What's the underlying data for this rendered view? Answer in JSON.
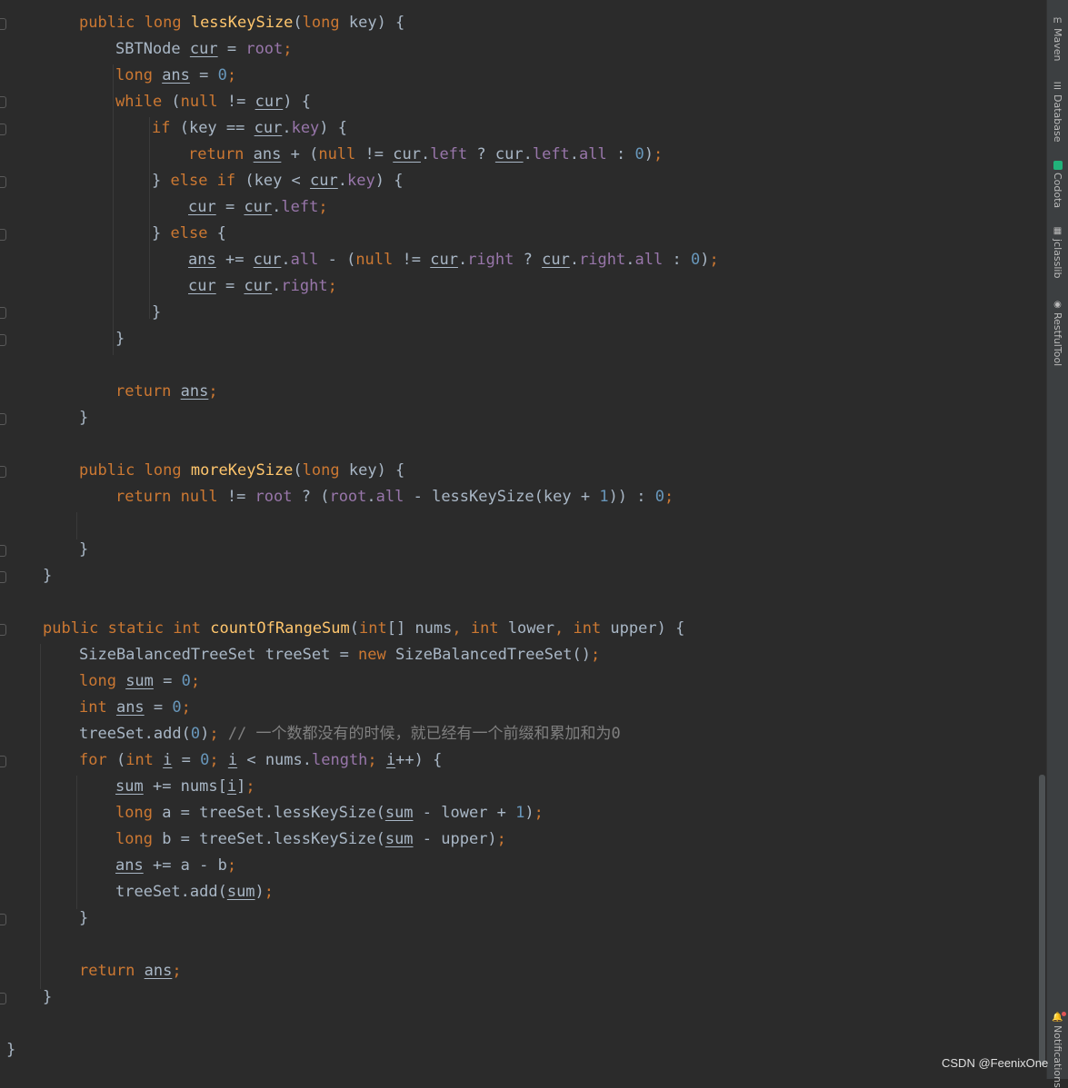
{
  "tool_windows": [
    {
      "label": "Maven",
      "icon": "maven-icon"
    },
    {
      "label": "Database",
      "icon": "database-icon"
    },
    {
      "label": "Codota",
      "icon": "codota-icon"
    },
    {
      "label": "jclasslib",
      "icon": "jclasslib-icon"
    },
    {
      "label": "RestfulTool",
      "icon": "restful-tool-icon"
    },
    {
      "label": "Notifications",
      "icon": "notifications-icon"
    }
  ],
  "watermark": "CSDN @FeenixOne",
  "colors": {
    "background": "#2b2b2b",
    "keyword": "#cc7832",
    "function": "#ffc66d",
    "number": "#6897bb",
    "field": "#9876aa",
    "comment": "#808080",
    "text": "#a9b7c6"
  },
  "code": [
    [
      [
        "kw",
        "public long "
      ],
      [
        "fn",
        "lessKeySize"
      ],
      [
        "",
        "("
      ],
      [
        "kw",
        "long "
      ],
      [
        "",
        "key) {"
      ]
    ],
    [
      [
        "",
        "SBTNode "
      ],
      [
        "var",
        "cur"
      ],
      [
        "",
        " = "
      ],
      [
        "fld",
        "root"
      ],
      [
        "kw",
        ";"
      ]
    ],
    [
      [
        "kw",
        "long "
      ],
      [
        "var",
        "ans"
      ],
      [
        "",
        " = "
      ],
      [
        "num",
        "0"
      ],
      [
        "kw",
        ";"
      ]
    ],
    [
      [
        "kw",
        "while "
      ],
      [
        "",
        "("
      ],
      [
        "kw",
        "null "
      ],
      [
        "",
        "!= "
      ],
      [
        "var",
        "cur"
      ],
      [
        "",
        ") {"
      ]
    ],
    [
      [
        "kw",
        "if "
      ],
      [
        "",
        "(key == "
      ],
      [
        "var",
        "cur"
      ],
      [
        "",
        "."
      ],
      [
        "fld",
        "key"
      ],
      [
        "",
        ") {"
      ]
    ],
    [
      [
        "kw",
        "return "
      ],
      [
        "var",
        "ans"
      ],
      [
        "",
        " + ("
      ],
      [
        "kw",
        "null "
      ],
      [
        "",
        "!= "
      ],
      [
        "var",
        "cur"
      ],
      [
        "",
        "."
      ],
      [
        "fld",
        "left"
      ],
      [
        "",
        " ? "
      ],
      [
        "var",
        "cur"
      ],
      [
        "",
        "."
      ],
      [
        "fld",
        "left"
      ],
      [
        "",
        "."
      ],
      [
        "fld",
        "all"
      ],
      [
        "",
        " : "
      ],
      [
        "num",
        "0"
      ],
      [
        "",
        ")"
      ],
      [
        "kw",
        ";"
      ]
    ],
    [
      [
        "",
        "} "
      ],
      [
        "kw",
        "else if "
      ],
      [
        "",
        "(key < "
      ],
      [
        "var",
        "cur"
      ],
      [
        "",
        "."
      ],
      [
        "fld",
        "key"
      ],
      [
        "",
        ") {"
      ]
    ],
    [
      [
        "var",
        "cur"
      ],
      [
        "",
        " = "
      ],
      [
        "var",
        "cur"
      ],
      [
        "",
        "."
      ],
      [
        "fld",
        "left"
      ],
      [
        "kw",
        ";"
      ]
    ],
    [
      [
        "",
        "} "
      ],
      [
        "kw",
        "else "
      ],
      [
        "",
        "{"
      ]
    ],
    [
      [
        "var",
        "ans"
      ],
      [
        "",
        " += "
      ],
      [
        "var",
        "cur"
      ],
      [
        "",
        "."
      ],
      [
        "fld",
        "all"
      ],
      [
        "",
        " - ("
      ],
      [
        "kw",
        "null "
      ],
      [
        "",
        "!= "
      ],
      [
        "var",
        "cur"
      ],
      [
        "",
        "."
      ],
      [
        "fld",
        "right"
      ],
      [
        "",
        " ? "
      ],
      [
        "var",
        "cur"
      ],
      [
        "",
        "."
      ],
      [
        "fld",
        "right"
      ],
      [
        "",
        "."
      ],
      [
        "fld",
        "all"
      ],
      [
        "",
        " : "
      ],
      [
        "num",
        "0"
      ],
      [
        "",
        ")"
      ],
      [
        "kw",
        ";"
      ]
    ],
    [
      [
        "var",
        "cur"
      ],
      [
        "",
        " = "
      ],
      [
        "var",
        "cur"
      ],
      [
        "",
        "."
      ],
      [
        "fld",
        "right"
      ],
      [
        "kw",
        ";"
      ]
    ],
    [
      [
        "",
        "}"
      ]
    ],
    [
      [
        "",
        "}"
      ]
    ],
    [],
    [
      [
        "kw",
        "return "
      ],
      [
        "var",
        "ans"
      ],
      [
        "kw",
        ";"
      ]
    ],
    [
      [
        "",
        "}"
      ]
    ],
    [],
    [
      [
        "kw",
        "public long "
      ],
      [
        "fn",
        "moreKeySize"
      ],
      [
        "",
        "("
      ],
      [
        "kw",
        "long "
      ],
      [
        "",
        "key) {"
      ]
    ],
    [
      [
        "kw",
        "return null "
      ],
      [
        "",
        "!= "
      ],
      [
        "fld",
        "root"
      ],
      [
        "",
        " ? ("
      ],
      [
        "fld",
        "root"
      ],
      [
        "",
        "."
      ],
      [
        "fld",
        "all"
      ],
      [
        "",
        " - lessKeySize(key + "
      ],
      [
        "num",
        "1"
      ],
      [
        "",
        ")) : "
      ],
      [
        "num",
        "0"
      ],
      [
        "kw",
        ";"
      ]
    ],
    [],
    [
      [
        "",
        "}"
      ]
    ],
    [
      [
        "",
        "}"
      ]
    ],
    [],
    [
      [
        "kw",
        "public static int "
      ],
      [
        "fn",
        "countOfRangeSum"
      ],
      [
        "",
        "("
      ],
      [
        "kw",
        "int"
      ],
      [
        "",
        "[] nums"
      ],
      [
        "kw",
        ", int "
      ],
      [
        "",
        "lower"
      ],
      [
        "kw",
        ", int "
      ],
      [
        "",
        "upper) {"
      ]
    ],
    [
      [
        "",
        "SizeBalancedTreeSet treeSet = "
      ],
      [
        "kw",
        "new "
      ],
      [
        "",
        "SizeBalancedTreeSet()"
      ],
      [
        "kw",
        ";"
      ]
    ],
    [
      [
        "kw",
        "long "
      ],
      [
        "var",
        "sum"
      ],
      [
        "",
        " = "
      ],
      [
        "num",
        "0"
      ],
      [
        "kw",
        ";"
      ]
    ],
    [
      [
        "kw",
        "int "
      ],
      [
        "var",
        "ans"
      ],
      [
        "",
        " = "
      ],
      [
        "num",
        "0"
      ],
      [
        "kw",
        ";"
      ]
    ],
    [
      [
        "",
        "treeSet.add("
      ],
      [
        "num",
        "0"
      ],
      [
        "",
        ")"
      ],
      [
        "kw",
        "; "
      ],
      [
        "cmt",
        "// 一个数都没有的时候，就已经有一个前缀和累加和为0"
      ]
    ],
    [
      [
        "kw",
        "for "
      ],
      [
        "",
        "("
      ],
      [
        "kw",
        "int "
      ],
      [
        "var",
        "i"
      ],
      [
        "",
        " = "
      ],
      [
        "num",
        "0"
      ],
      [
        "kw",
        "; "
      ],
      [
        "var",
        "i"
      ],
      [
        "",
        " < nums."
      ],
      [
        "fld",
        "length"
      ],
      [
        "kw",
        "; "
      ],
      [
        "var",
        "i"
      ],
      [
        "",
        "++) {"
      ]
    ],
    [
      [
        "var",
        "sum"
      ],
      [
        "",
        " += nums["
      ],
      [
        "var",
        "i"
      ],
      [
        "",
        "]"
      ],
      [
        "kw",
        ";"
      ]
    ],
    [
      [
        "kw",
        "long "
      ],
      [
        "",
        "a = treeSet.lessKeySize("
      ],
      [
        "var",
        "sum"
      ],
      [
        "",
        " - lower + "
      ],
      [
        "num",
        "1"
      ],
      [
        "",
        ")"
      ],
      [
        "kw",
        ";"
      ]
    ],
    [
      [
        "kw",
        "long "
      ],
      [
        "",
        "b = treeSet.lessKeySize("
      ],
      [
        "var",
        "sum"
      ],
      [
        "",
        " - upper)"
      ],
      [
        "kw",
        ";"
      ]
    ],
    [
      [
        "var",
        "ans"
      ],
      [
        "",
        " += a - b"
      ],
      [
        "kw",
        ";"
      ]
    ],
    [
      [
        "",
        "treeSet.add("
      ],
      [
        "var",
        "sum"
      ],
      [
        "",
        ")"
      ],
      [
        "kw",
        ";"
      ]
    ],
    [
      [
        "",
        "}"
      ]
    ],
    [],
    [
      [
        "kw",
        "return "
      ],
      [
        "var",
        "ans"
      ],
      [
        "kw",
        ";"
      ]
    ],
    [
      [
        "",
        "}"
      ]
    ],
    [],
    [
      [
        "",
        "}"
      ]
    ]
  ]
}
